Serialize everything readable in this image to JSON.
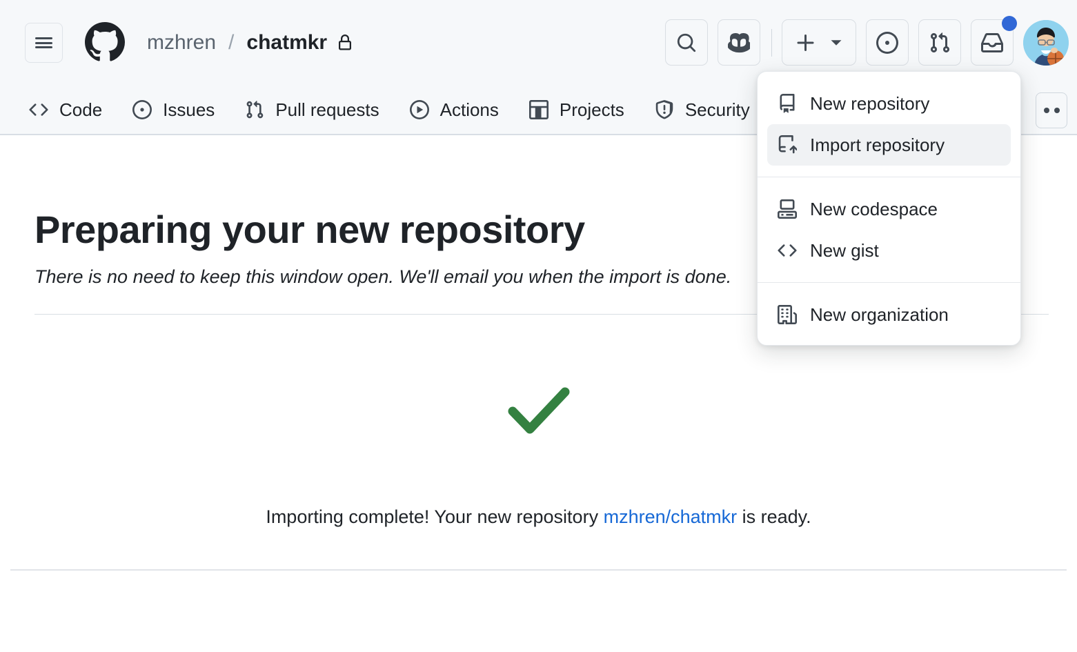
{
  "header": {
    "hamburger_label": "Open navigation menu",
    "logo": "github-mark",
    "breadcrumb": {
      "owner": "mzhren",
      "separator": "/",
      "repo": "chatmkr",
      "visibility_icon": "lock-icon"
    },
    "actions": [
      {
        "name": "search-button",
        "icon": "search-icon"
      },
      {
        "name": "copilot-button",
        "icon": "copilot-icon"
      },
      {
        "name": "create-new-button",
        "icon": "plus-icon",
        "chevron": "chevron-down-icon"
      },
      {
        "name": "issues-button",
        "icon": "issue-opened-icon"
      },
      {
        "name": "pull-requests-button",
        "icon": "git-pull-request-icon"
      },
      {
        "name": "notifications-button",
        "icon": "inbox-icon",
        "has_unread": true
      },
      {
        "name": "user-avatar",
        "icon": "avatar"
      }
    ],
    "notification_dot_color": "#3168d6"
  },
  "nav": {
    "tabs": [
      {
        "label": "Code",
        "icon": "code-icon"
      },
      {
        "label": "Issues",
        "icon": "issue-opened-icon"
      },
      {
        "label": "Pull requests",
        "icon": "git-pull-request-icon"
      },
      {
        "label": "Actions",
        "icon": "play-icon"
      },
      {
        "label": "Projects",
        "icon": "table-icon"
      },
      {
        "label": "Security",
        "icon": "shield-icon"
      }
    ],
    "overflow_label": "More"
  },
  "main": {
    "title": "Preparing your new repository",
    "subtitle": "There is no need to keep this window open. We'll email you when the import is done.",
    "status_icon": "check-icon",
    "status_icon_color": "#348141",
    "status_prefix": "Importing complete! Your new repository ",
    "status_link": "mzhren/chatmkr",
    "status_suffix": " is ready.",
    "link_color": "#1668d6"
  },
  "create_menu": {
    "groups": [
      {
        "items": [
          {
            "label": "New repository",
            "icon": "repo-icon",
            "active": false
          },
          {
            "label": "Import repository",
            "icon": "repo-push-icon",
            "active": true
          }
        ]
      },
      {
        "items": [
          {
            "label": "New codespace",
            "icon": "codespaces-icon",
            "active": false
          },
          {
            "label": "New gist",
            "icon": "code-icon",
            "active": false
          }
        ]
      },
      {
        "items": [
          {
            "label": "New organization",
            "icon": "organization-icon",
            "active": false
          }
        ]
      }
    ]
  }
}
